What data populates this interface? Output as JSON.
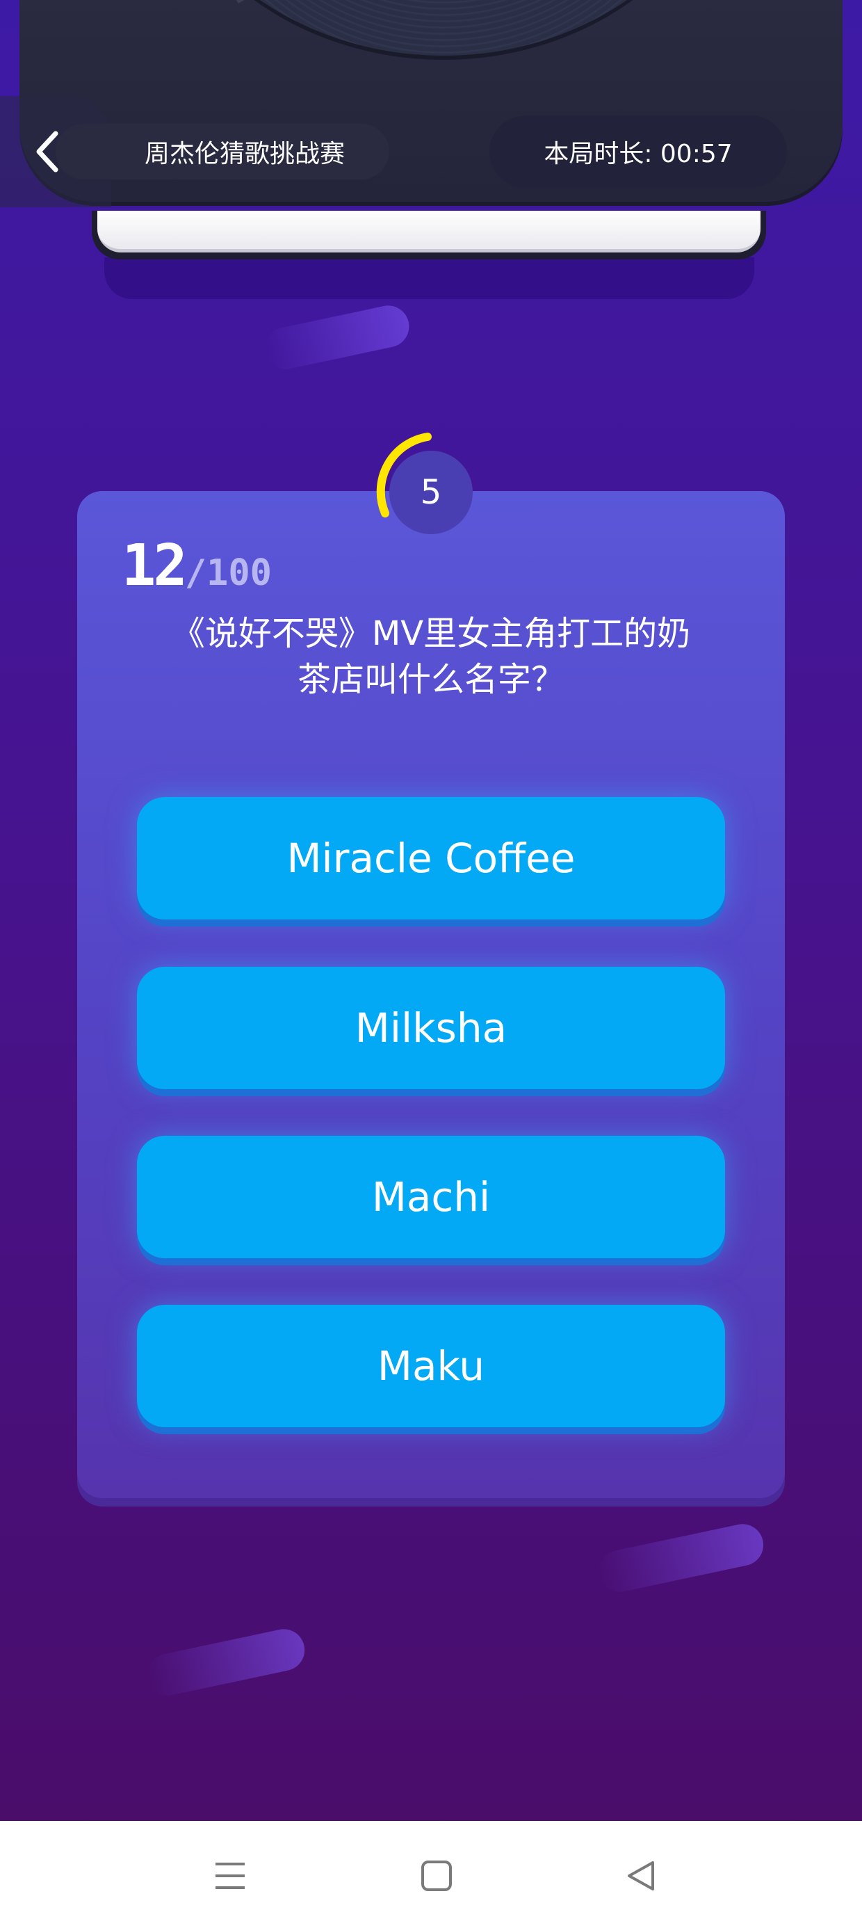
{
  "header": {
    "title": "周杰伦猜歌挑战赛",
    "timer": "本局时长: 00:57",
    "back_icon": "chevron-left-icon"
  },
  "countdown": {
    "value": "5",
    "arc_color": "#ffe600"
  },
  "quiz": {
    "current": "12",
    "total": "/100",
    "question": "《说好不哭》MV里女主角打工的奶茶店叫什么名字？",
    "options": [
      {
        "label": "Miracle Coffee"
      },
      {
        "label": "Milksha"
      },
      {
        "label": "Machi"
      },
      {
        "label": "Maku"
      }
    ]
  },
  "navbar": {
    "icons": [
      "menu-icon",
      "home-square-icon",
      "back-triangle-icon"
    ]
  },
  "colors": {
    "option_bg": "#04a9f5",
    "card_bg": "#5a57d8",
    "background": "#3d1aa6"
  }
}
